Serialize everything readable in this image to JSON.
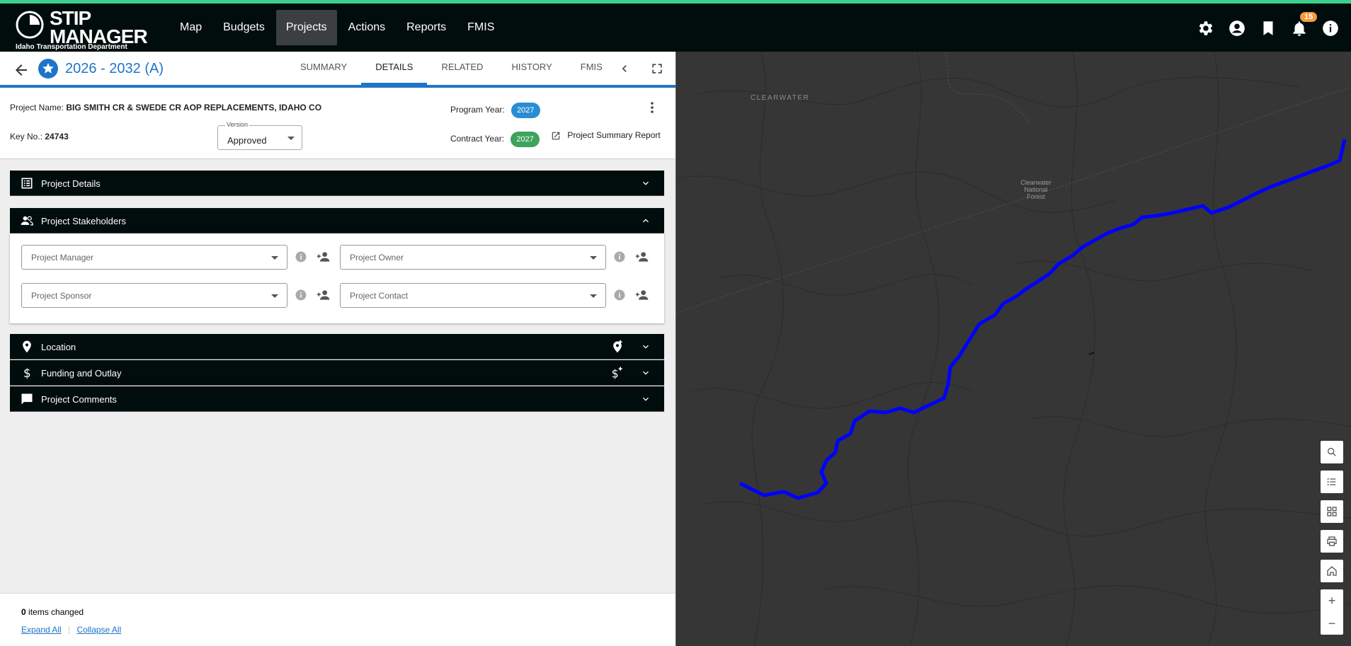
{
  "app": {
    "logo_line1": "STIP",
    "logo_line2": "MANAGER",
    "logo_sub": "Idaho Transportation Department",
    "nav": [
      {
        "label": "Map"
      },
      {
        "label": "Budgets"
      },
      {
        "label": "Projects"
      },
      {
        "label": "Actions"
      },
      {
        "label": "Reports"
      },
      {
        "label": "FMIS"
      }
    ],
    "active_nav": "Projects",
    "notification_count": "15"
  },
  "header": {
    "title": "2026 - 2032 (A)",
    "tabs": [
      "SUMMARY",
      "DETAILS",
      "RELATED",
      "HISTORY",
      "FMIS"
    ],
    "active_tab": "DETAILS"
  },
  "project": {
    "name_label": "Project Name:",
    "name": "BIG SMITH CR & SWEDE CR AOP REPLACEMENTS, IDAHO CO",
    "key_label": "Key No.:",
    "key": "24743",
    "version_label": "Version",
    "version": "Approved",
    "program_year_label": "Program Year:",
    "program_year": "2027",
    "contract_year_label": "Contract Year:",
    "contract_year": "2027",
    "report_link": "Project Summary Report"
  },
  "panels": {
    "details": "Project Details",
    "stakeholders": "Project Stakeholders",
    "location": "Location",
    "funding": "Funding and Outlay",
    "comments": "Project Comments"
  },
  "stakeholders": {
    "manager": "Project Manager",
    "owner": "Project Owner",
    "sponsor": "Project Sponsor",
    "contact": "Project Contact"
  },
  "footer": {
    "changed_count": "0",
    "changed_label": "items changed",
    "expand_all": "Expand All",
    "collapse_all": "Collapse All"
  },
  "map": {
    "label_region": "CLEARWATER",
    "label_forest_1": "Clearwater",
    "label_forest_2": "National",
    "label_forest_3": "Forest",
    "route_color": "#0000ff"
  },
  "colors": {
    "accent": "#1e74c8",
    "topbar": "#000d0c",
    "topbar_stripe": "#3ecf8e",
    "program_year_pill": "#2a8dd4",
    "contract_year_pill": "#3da35d",
    "badge": "#f59a3c"
  }
}
